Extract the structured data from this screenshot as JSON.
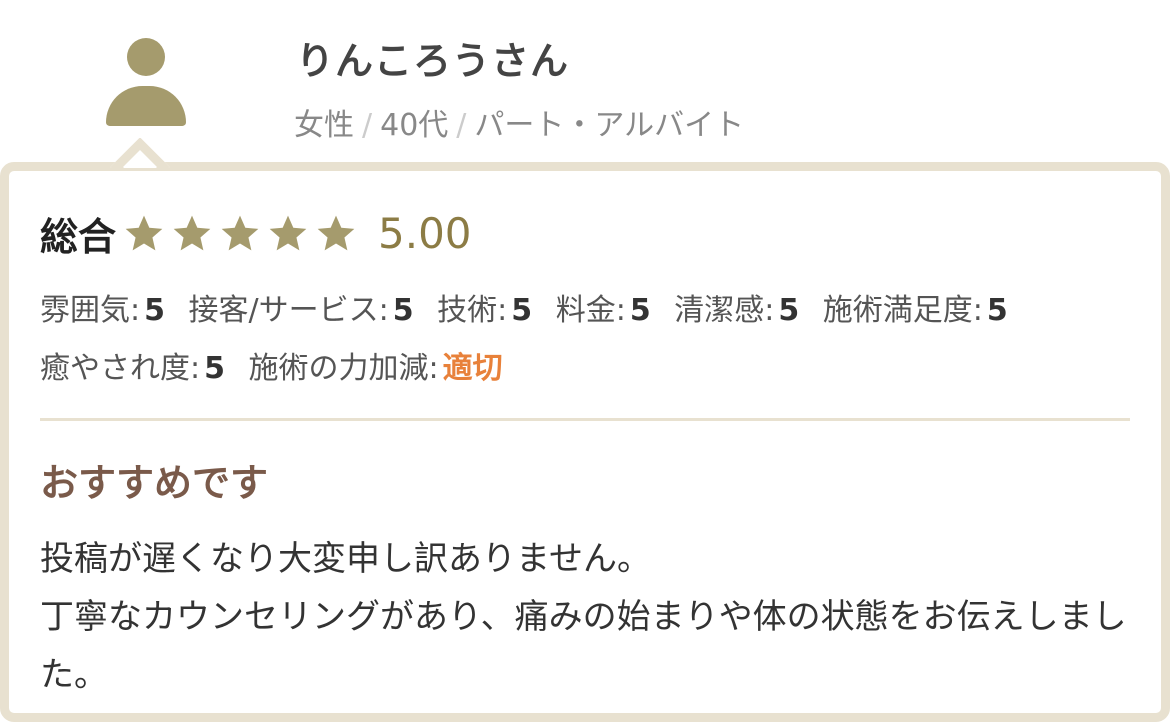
{
  "reviewer": {
    "name": "りんころうさん",
    "gender": "女性",
    "age": "40代",
    "occupation": "パート・アルバイト",
    "separator": "/"
  },
  "overall": {
    "label": "総合",
    "stars": 5,
    "max_stars": 5,
    "score": "5.00"
  },
  "ratings": [
    {
      "label": "雰囲気:",
      "value": "5"
    },
    {
      "label": "接客/サービス:",
      "value": "5"
    },
    {
      "label": "技術:",
      "value": "5"
    },
    {
      "label": "料金:",
      "value": "5"
    },
    {
      "label": "清潔感:",
      "value": "5"
    },
    {
      "label": "施術満足度:",
      "value": "5"
    },
    {
      "label": "癒やされ度:",
      "value": "5"
    },
    {
      "label": "施術の力加減:",
      "value": "適切"
    }
  ],
  "review": {
    "title": "おすすめです",
    "lines": [
      "投稿が遅くなり大変申し訳ありません。",
      "丁寧なカウンセリングがあり、痛みの始まりや体の状態をお伝えしました。"
    ]
  },
  "colors": {
    "accent": "#e8813a",
    "star": "#a59b6d",
    "score": "#8c7c45",
    "title": "#7a5a4a",
    "border": "#e8e1d0"
  },
  "icons": {
    "avatar": "user-avatar-icon",
    "star": "star-icon"
  }
}
